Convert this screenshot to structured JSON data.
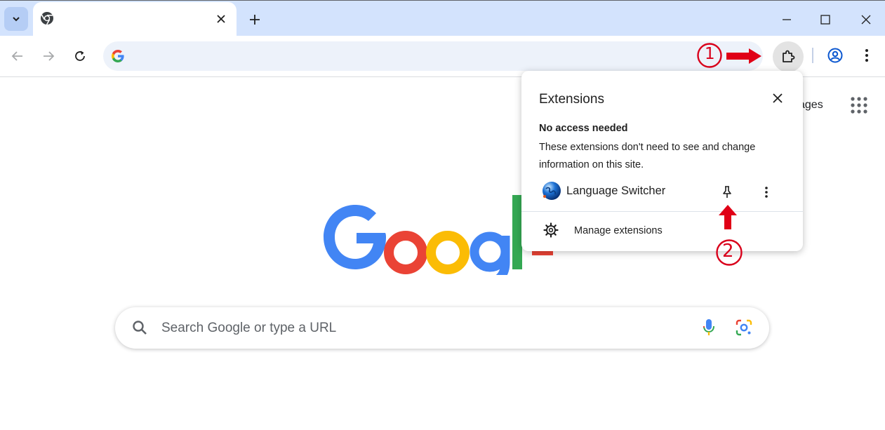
{
  "browser": {
    "tab": {
      "title": ""
    },
    "omnibox": {
      "value": ""
    }
  },
  "annotations": {
    "step1": "1",
    "step2": "2"
  },
  "newtab": {
    "images_link": "ages",
    "search": {
      "placeholder": "Search Google or type a URL"
    }
  },
  "extensions_popup": {
    "title": "Extensions",
    "section_heading": "No access needed",
    "section_description": "These extensions don't need to see and change information on this site.",
    "extensions": [
      {
        "name": "Language Switcher"
      }
    ],
    "manage_label": "Manage extensions"
  },
  "colors": {
    "tabstrip": "#d3e3fd",
    "omnibox": "#edf2fa",
    "annotation_red": "#d9001b",
    "google_blue": "#4285f4",
    "google_red": "#ea4335",
    "google_yellow": "#fbbc05",
    "google_green": "#34a853"
  },
  "icons": [
    "tab-search-icon",
    "chrome-favicon",
    "close-icon",
    "plus-icon",
    "minimize-icon",
    "maximize-icon",
    "back-icon",
    "forward-icon",
    "reload-icon",
    "google-g-icon",
    "puzzle-icon",
    "profile-icon",
    "kebab-menu-icon",
    "apps-grid-icon",
    "search-icon",
    "mic-icon",
    "lens-icon",
    "globe-icon",
    "pin-icon",
    "gear-icon",
    "red-arrow-icon"
  ]
}
